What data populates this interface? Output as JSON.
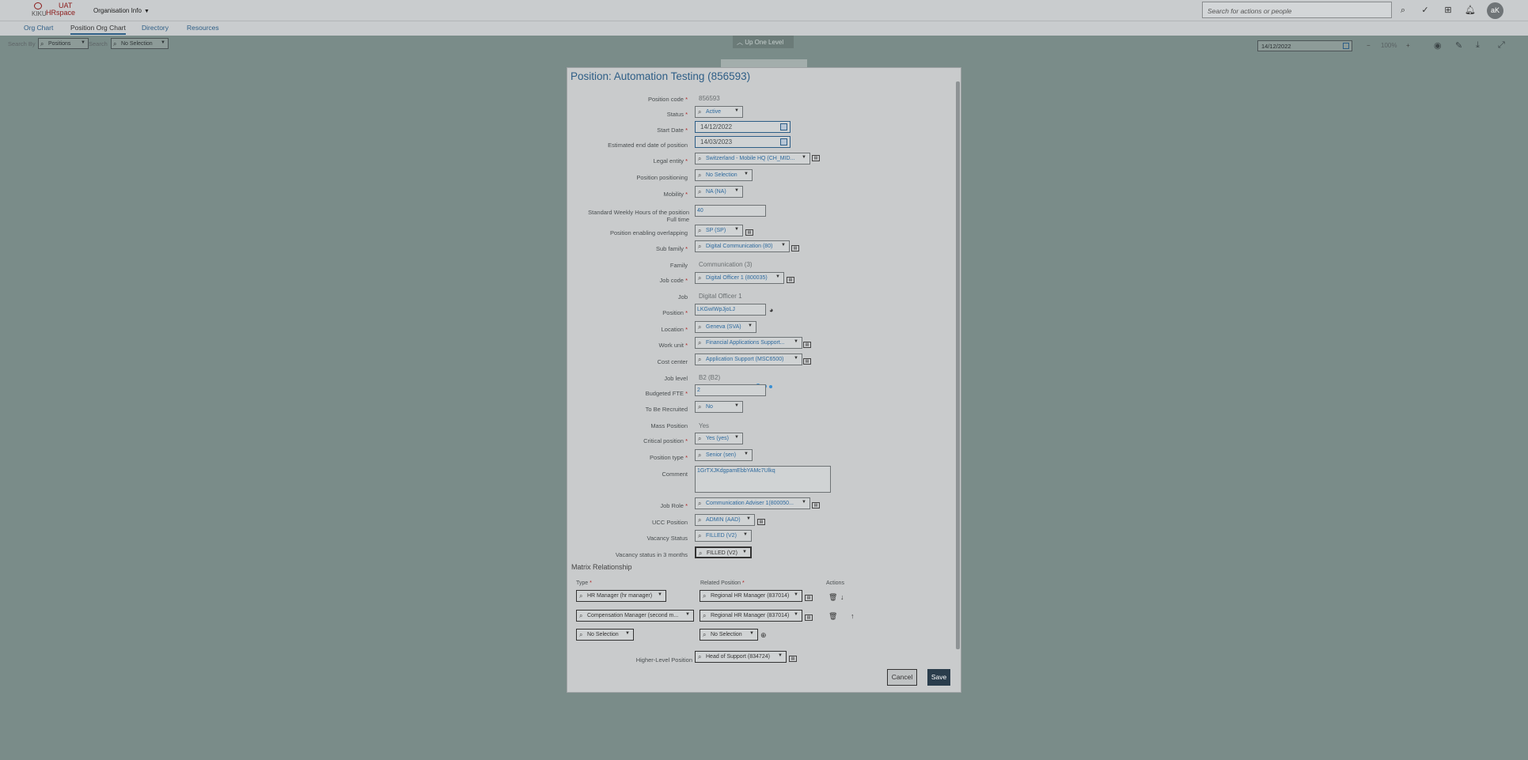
{
  "app": {
    "logo_line1": "KIKU",
    "logo_uat": "UAT",
    "logo_hr": "HRspace",
    "menu_label": "Organisation Info",
    "search_placeholder": "Search for actions or people",
    "avatar_initials": "aK"
  },
  "nav": {
    "tabs": [
      "Org Chart",
      "Position Org Chart",
      "Directory",
      "Resources"
    ]
  },
  "filters": {
    "search_by_label": "Search By",
    "search_by_value": "Positions",
    "search_label": "Search",
    "search_value": "No Selection",
    "up_one_level": "Up One Level",
    "date": "14/12/2022",
    "zoom": "100%"
  },
  "dialog": {
    "title": "Position: Automation Testing (856593)",
    "fields": {
      "position_code": {
        "label": "Position code",
        "value": "856593"
      },
      "status": {
        "label": "Status",
        "value": "Active"
      },
      "start_date": {
        "label": "Start Date",
        "value": "14/12/2022"
      },
      "end_date": {
        "label": "Estimated end date of position",
        "value": "14/03/2023"
      },
      "legal_entity": {
        "label": "Legal entity",
        "value": "Switzerland - Mobile HQ (CH_MID..."
      },
      "position_positioning": {
        "label": "Position positioning",
        "value": "No Selection"
      },
      "mobility": {
        "label": "Mobility",
        "value": "NA (NA)"
      },
      "weekly_hours": {
        "label": "Standard Weekly Hours of the position Full time",
        "value": "40"
      },
      "overlapping": {
        "label": "Position enabling overlapping",
        "value": "SP (SP)"
      },
      "sub_family": {
        "label": "Sub family",
        "value": "Digital Communication (80)"
      },
      "family": {
        "label": "Family",
        "value": "Communication (3)"
      },
      "job_code": {
        "label": "Job code",
        "value": "Digital Officer 1 (800035)"
      },
      "job": {
        "label": "Job",
        "value": "Digital Officer 1"
      },
      "position": {
        "label": "Position",
        "value": "LKGwIWpJjoLJ"
      },
      "location": {
        "label": "Location",
        "value": "Geneva (SVA)"
      },
      "work_unit": {
        "label": "Work unit",
        "value": "Financial Applications Support..."
      },
      "cost_center": {
        "label": "Cost center",
        "value": "Application Support (MSC6500)"
      },
      "job_level": {
        "label": "Job level",
        "value": "B2 (B2)"
      },
      "budgeted_fte": {
        "label": "Budgeted FTE",
        "value": "2"
      },
      "to_be_recruited": {
        "label": "To Be Recruited",
        "value": "No"
      },
      "mass_position": {
        "label": "Mass Position",
        "value": "Yes"
      },
      "critical_position": {
        "label": "Critical position",
        "value": "Yes (yes)"
      },
      "position_type": {
        "label": "Position type",
        "value": "Senior (sen)"
      },
      "comment": {
        "label": "Comment",
        "value": "1GrTXJKdgpamEbbYAMc7Ulkq"
      },
      "job_role": {
        "label": "Job Role",
        "value": "Communication Adviser 1(800050..."
      },
      "ucc_position": {
        "label": "UCC Position",
        "value": "ADMIN (AAD)"
      },
      "vacancy_status": {
        "label": "Vacancy Status",
        "value": "FILLED (V2)"
      },
      "vacancy_3m": {
        "label": "Vacancy status in 3 months",
        "value": "FILLED (V2)"
      },
      "higher_level": {
        "label": "Higher-Level Position",
        "value": "Head of Support (834724)"
      }
    },
    "matrix": {
      "title": "Matrix Relationship",
      "col_type": "Type",
      "col_related": "Related Position",
      "col_actions": "Actions",
      "rows": [
        {
          "type": "HR Manager (hr manager)",
          "related": "Regional HR Manager (837014)"
        },
        {
          "type": "Compensation Manager (second m...",
          "related": "Regional HR Manager (837014)"
        },
        {
          "type": "No Selection",
          "related": "No Selection"
        }
      ]
    },
    "cancel_label": "Cancel",
    "save_label": "Save"
  }
}
